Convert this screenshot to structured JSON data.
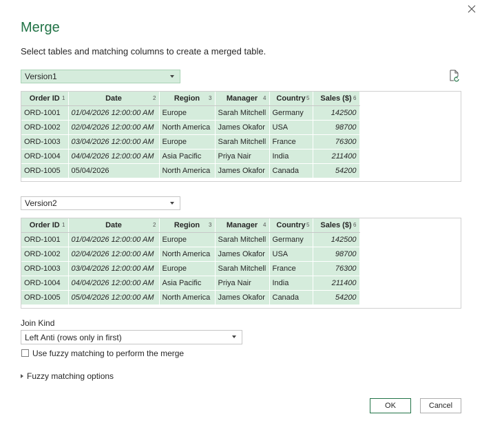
{
  "dialog": {
    "title": "Merge",
    "subtitle": "Select tables and matching columns to create a merged table."
  },
  "table1": {
    "selected": "Version1",
    "columns": [
      {
        "label": "Order ID",
        "n": "1"
      },
      {
        "label": "Date",
        "n": "2"
      },
      {
        "label": "Region",
        "n": "3"
      },
      {
        "label": "Manager",
        "n": "4"
      },
      {
        "label": "Country",
        "n": "5"
      },
      {
        "label": "Sales ($)",
        "n": "6"
      }
    ],
    "rows": [
      [
        "ORD-1001",
        "01/04/2026 12:00:00 AM",
        "Europe",
        "Sarah Mitchell",
        "Germany",
        "142500"
      ],
      [
        "ORD-1002",
        "02/04/2026 12:00:00 AM",
        "North America",
        "James Okafor",
        "USA",
        "98700"
      ],
      [
        "ORD-1003",
        "03/04/2026 12:00:00 AM",
        "Europe",
        "Sarah Mitchell",
        "France",
        "76300"
      ],
      [
        "ORD-1004",
        "04/04/2026 12:00:00 AM",
        "Asia Pacific",
        "Priya Nair",
        "India",
        "211400"
      ],
      [
        "ORD-1005",
        "05/04/2026",
        "North America",
        "James Okafor",
        "Canada",
        "54200"
      ]
    ]
  },
  "table2": {
    "selected": "Version2",
    "columns": [
      {
        "label": "Order ID",
        "n": "1"
      },
      {
        "label": "Date",
        "n": "2"
      },
      {
        "label": "Region",
        "n": "3"
      },
      {
        "label": "Manager",
        "n": "4"
      },
      {
        "label": "Country",
        "n": "5"
      },
      {
        "label": "Sales ($)",
        "n": "6"
      }
    ],
    "rows": [
      [
        "ORD-1001",
        "01/04/2026 12:00:00 AM",
        "Europe",
        "Sarah Mitchell",
        "Germany",
        "142500"
      ],
      [
        "ORD-1002",
        "02/04/2026 12:00:00 AM",
        "North America",
        "James Okafor",
        "USA",
        "98700"
      ],
      [
        "ORD-1003",
        "03/04/2026 12:00:00 AM",
        "Europe",
        "Sarah Mitchell",
        "France",
        "76300"
      ],
      [
        "ORD-1004",
        "04/04/2026 12:00:00 AM",
        "Asia Pacific",
        "Priya Nair",
        "India",
        "211400"
      ],
      [
        "ORD-1005",
        "05/04/2026 12:00:00 AM",
        "North America",
        "James Okafor",
        "Canada",
        "54200"
      ]
    ]
  },
  "join": {
    "label": "Join Kind",
    "selected": "Left Anti (rows only in first)"
  },
  "fuzzy": {
    "checkbox_label": "Use fuzzy matching to perform the merge",
    "checked": false,
    "options_label": "Fuzzy matching options"
  },
  "buttons": {
    "ok": "OK",
    "cancel": "Cancel"
  },
  "icons": {
    "close": "close-icon",
    "refresh": "refresh-icon"
  },
  "colors": {
    "accent": "#217346",
    "selection": "#d5ecdc"
  }
}
